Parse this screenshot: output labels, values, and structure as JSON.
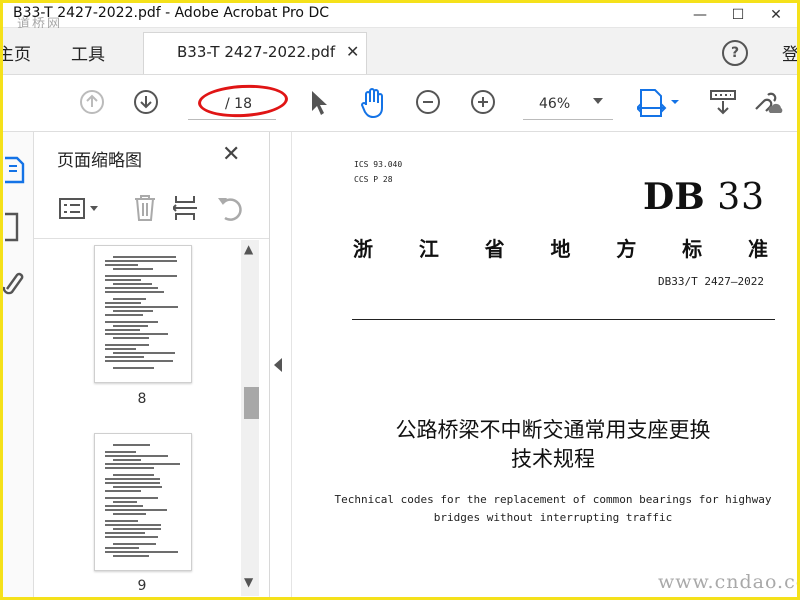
{
  "window": {
    "title": "B33-T  2427-2022.pdf - Adobe Acrobat Pro DC",
    "watermark_overlay": "道桥网"
  },
  "menubar": {
    "home": "主页",
    "tools": "工具",
    "doc_tab": "B33-T  2427-2022.pdf",
    "login": "登"
  },
  "toolbar": {
    "page_indicator": "/ 18",
    "zoom": "46%",
    "highlight_color": "#e01515"
  },
  "thumbnail_panel": {
    "title": "页面缩略图",
    "pages": [
      {
        "number": "8"
      },
      {
        "number": "9"
      }
    ]
  },
  "document": {
    "ics": "ICS  93.040",
    "ccs": "CCS  P 28",
    "logo_letters": "DB",
    "logo_number": "33",
    "standard_name": [
      "浙",
      "江",
      "省",
      "地",
      "方",
      "标",
      "准"
    ],
    "standard_number": "DB33/T 2427—2022",
    "title_cn_line1": "公路桥梁不中断交通常用支座更换",
    "title_cn_line2": "技术规程",
    "title_en_line1": "Technical codes for the replacement of common bearings for highway",
    "title_en_line2": "bridges without interrupting traffic"
  },
  "site_watermark": "www.cndao.com",
  "colors": {
    "frame": "#f5e11a",
    "accent_blue": "#1473e6"
  }
}
